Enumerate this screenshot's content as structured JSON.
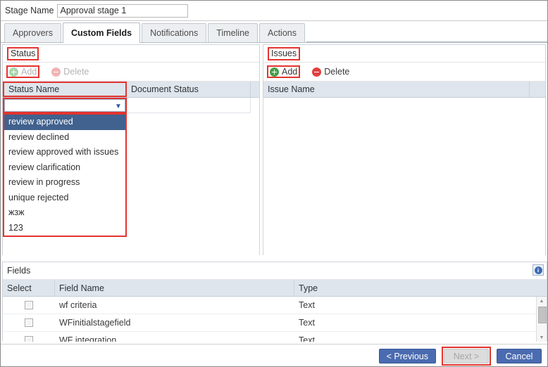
{
  "stage": {
    "label": "Stage Name",
    "value": "Approval stage 1",
    "placeholder": ""
  },
  "tabs": [
    {
      "label": "Approvers",
      "active": false
    },
    {
      "label": "Custom Fields",
      "active": true
    },
    {
      "label": "Notifications",
      "active": false
    },
    {
      "label": "Timeline",
      "active": false
    },
    {
      "label": "Actions",
      "active": false
    }
  ],
  "status_panel": {
    "title": "Status",
    "add_label": "Add",
    "delete_label": "Delete",
    "add_enabled": false,
    "delete_enabled": false,
    "columns": [
      "Status Name",
      "Document Status"
    ],
    "combo_value": "",
    "dropdown_options": [
      "review approved",
      "review declined",
      "review approved with issues",
      "review clarification",
      "review in progress",
      "unique rejected",
      "жзж",
      "123"
    ],
    "selected_option": "review approved"
  },
  "issues_panel": {
    "title": "Issues",
    "add_label": "Add",
    "delete_label": "Delete",
    "add_enabled": true,
    "delete_enabled": true,
    "columns": [
      "Issue Name"
    ]
  },
  "fields_panel": {
    "title": "Fields",
    "info_icon": "info-icon",
    "info_glyph": "i",
    "columns": [
      "Select",
      "Field Name",
      "Type"
    ],
    "rows": [
      {
        "field_name": "wf criteria",
        "type": "Text"
      },
      {
        "field_name": "WFinitialstagefield",
        "type": "Text"
      },
      {
        "field_name": "WF integration",
        "type": "Text"
      }
    ]
  },
  "footer": {
    "previous_label": "< Previous",
    "next_label": "Next >",
    "cancel_label": "Cancel",
    "next_enabled": false
  },
  "colors": {
    "highlight": "#e3342f",
    "accent": "#4a6bb0",
    "header_bg": "#dfe5ec",
    "selected_item": "#41618e",
    "add_green": "#43a047",
    "delete_red": "#e04040"
  }
}
